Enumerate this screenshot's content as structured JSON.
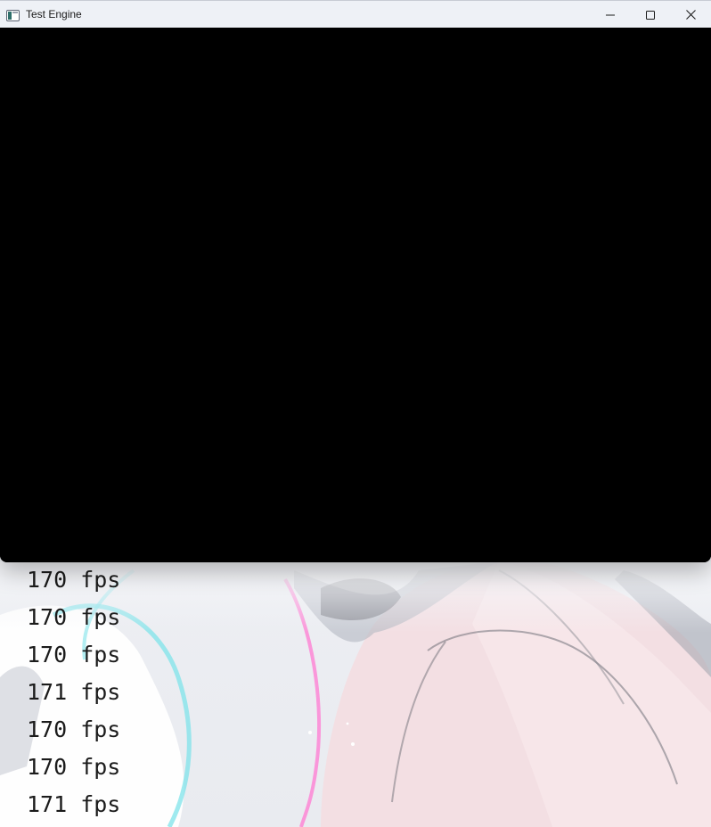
{
  "window": {
    "title": "Test Engine",
    "controls": [
      "minimize-icon",
      "maximize-icon",
      "close-icon"
    ]
  },
  "console": {
    "lines": [
      "170 fps",
      "170 fps",
      "170 fps",
      "171 fps",
      "170 fps",
      "170 fps",
      "171 fps"
    ]
  },
  "colors": {
    "titlebar": "#eef1f6",
    "canvas": "#000000",
    "console_text": "#1b1b1b"
  }
}
